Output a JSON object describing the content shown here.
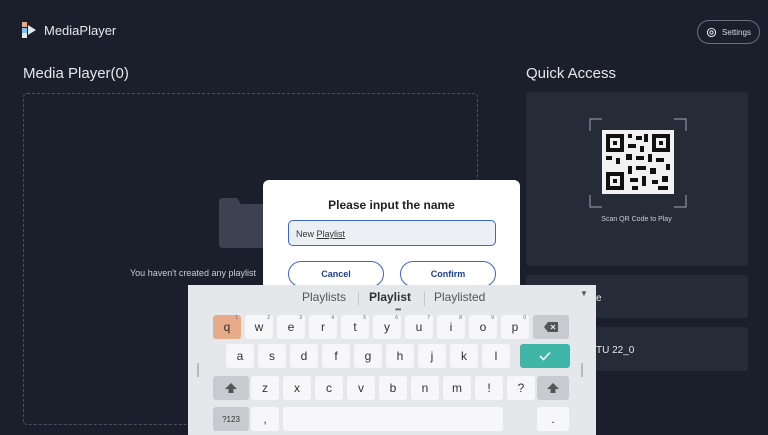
{
  "app": {
    "title": "MediaPlayer"
  },
  "header": {
    "settings_label": "Settings"
  },
  "media_player": {
    "title": "Media Player(0)",
    "empty_text": "You haven't created any playlist"
  },
  "quick_access": {
    "title": "Quick Access",
    "scan_text": "Scan QR Code to Play",
    "item1_text": "e",
    "item2_text": "TU 22_0"
  },
  "dialog": {
    "title": "Please input the name",
    "input_prefix": "New ",
    "input_word": "Playlist",
    "cancel_label": "Cancel",
    "confirm_label": "Confirm"
  },
  "keyboard": {
    "suggestions": [
      "Playlists",
      "Playlist",
      "Playlisted"
    ],
    "row1": [
      {
        "k": "q",
        "h": "1"
      },
      {
        "k": "w",
        "h": "2"
      },
      {
        "k": "e",
        "h": "3"
      },
      {
        "k": "r",
        "h": "4"
      },
      {
        "k": "t",
        "h": "5"
      },
      {
        "k": "y",
        "h": "6"
      },
      {
        "k": "u",
        "h": "7"
      },
      {
        "k": "i",
        "h": "8"
      },
      {
        "k": "o",
        "h": "9"
      },
      {
        "k": "p",
        "h": "0"
      }
    ],
    "row2": [
      "a",
      "s",
      "d",
      "f",
      "g",
      "h",
      "j",
      "k",
      "l"
    ],
    "row3": [
      "z",
      "x",
      "c",
      "v",
      "b",
      "n",
      "m",
      "!",
      "?"
    ],
    "symbols_label": "?123",
    "comma": ",",
    "period": "."
  },
  "colors": {
    "background": "#1b1f2b",
    "card": "#262b38",
    "accent_blue": "#3a66c9",
    "key_highlight": "#e8ab8a",
    "enter_key": "#3fb6a8"
  }
}
